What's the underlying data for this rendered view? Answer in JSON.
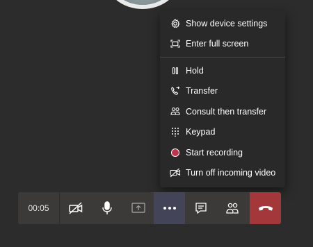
{
  "menu": {
    "items": [
      {
        "label": "Show device settings",
        "icon": "gear-icon"
      },
      {
        "label": "Enter full screen",
        "icon": "fullscreen-icon"
      },
      {
        "label": "Hold",
        "icon": "pause-icon"
      },
      {
        "label": "Transfer",
        "icon": "phone-transfer-icon"
      },
      {
        "label": "Consult then transfer",
        "icon": "people-icon"
      },
      {
        "label": "Keypad",
        "icon": "keypad-icon"
      },
      {
        "label": "Start recording",
        "icon": "record-icon"
      },
      {
        "label": "Turn off incoming video",
        "icon": "video-off-icon"
      }
    ]
  },
  "toolbar": {
    "timer": "00:05",
    "buttons": [
      "camera-off-icon",
      "microphone-icon",
      "share-screen-icon",
      "more-options-icon",
      "chat-icon",
      "participants-icon",
      "hang-up-icon"
    ]
  },
  "colors": {
    "background": "#2d2c2c",
    "menu_bg": "#292929",
    "toolbar_bg": "#3b3a39",
    "active_button": "#444458",
    "hangup": "#a4373a",
    "record": "#c4314b"
  }
}
